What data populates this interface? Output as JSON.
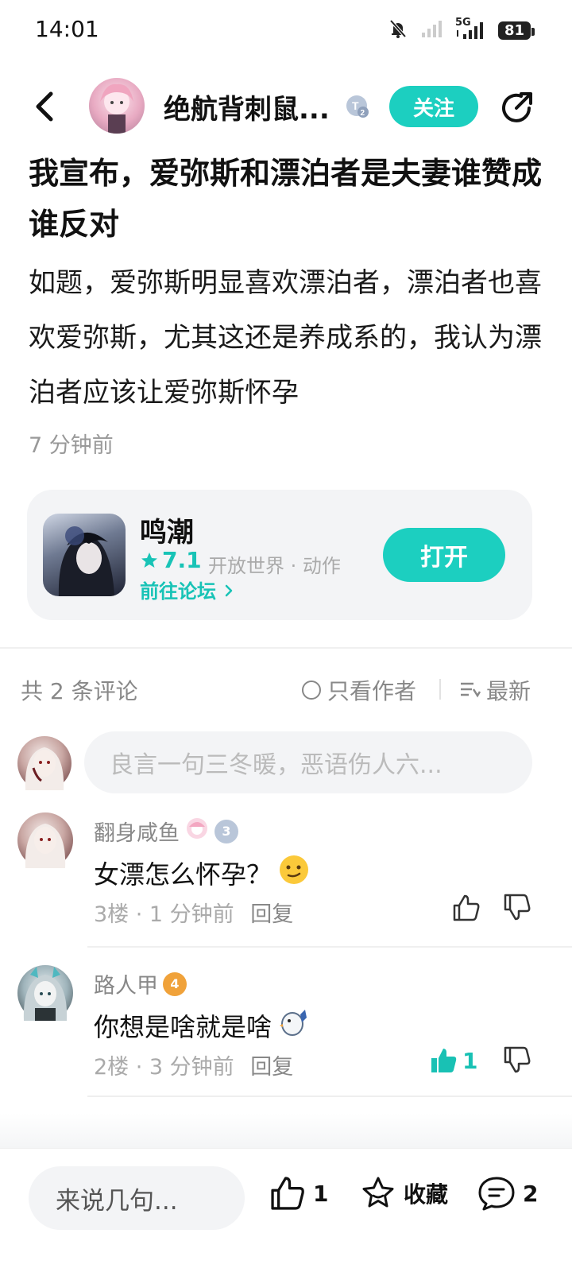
{
  "status_bar": {
    "time": "14:01",
    "network": "5G",
    "battery": "81"
  },
  "header": {
    "author_name": "绝航背刺鼠...",
    "level": "2",
    "follow_label": "关注"
  },
  "post": {
    "title": "我宣布，爱弥斯和漂泊者是夫妻谁赞成谁反对",
    "body": "如题，爱弥斯明显喜欢漂泊者，漂泊者也喜欢爱弥斯，尤其这还是养成系的，我认为漂泊者应该让爱弥斯怀孕",
    "time": "7 分钟前"
  },
  "game_card": {
    "name": "鸣潮",
    "rating": "7.1",
    "genre": "开放世界 · 动作",
    "forum_link": "前往论坛",
    "open_label": "打开"
  },
  "comments_section": {
    "count_label": "共 2 条评论",
    "author_only_label": "只看作者",
    "sort_label": "最新",
    "input_placeholder": "良言一句三冬暖，恶语伤人六..."
  },
  "comments": [
    {
      "name": "翻身咸鱼",
      "level": "3",
      "text": "女漂怎么怀孕？",
      "floor_time": "3楼 · 1 分钟前",
      "reply_label": "回复",
      "likes": ""
    },
    {
      "name": "路人甲",
      "level": "4",
      "text": "你想是啥就是啥",
      "floor_time": "2楼 · 3 分钟前",
      "reply_label": "回复",
      "likes": "1"
    }
  ],
  "bottom_bar": {
    "input_placeholder": "来说几句...",
    "like_count": "1",
    "favorite_label": "收藏",
    "comment_count": "2"
  },
  "colors": {
    "accent": "#1ccfc0",
    "muted": "#888888",
    "card_bg": "#f3f4f6"
  }
}
